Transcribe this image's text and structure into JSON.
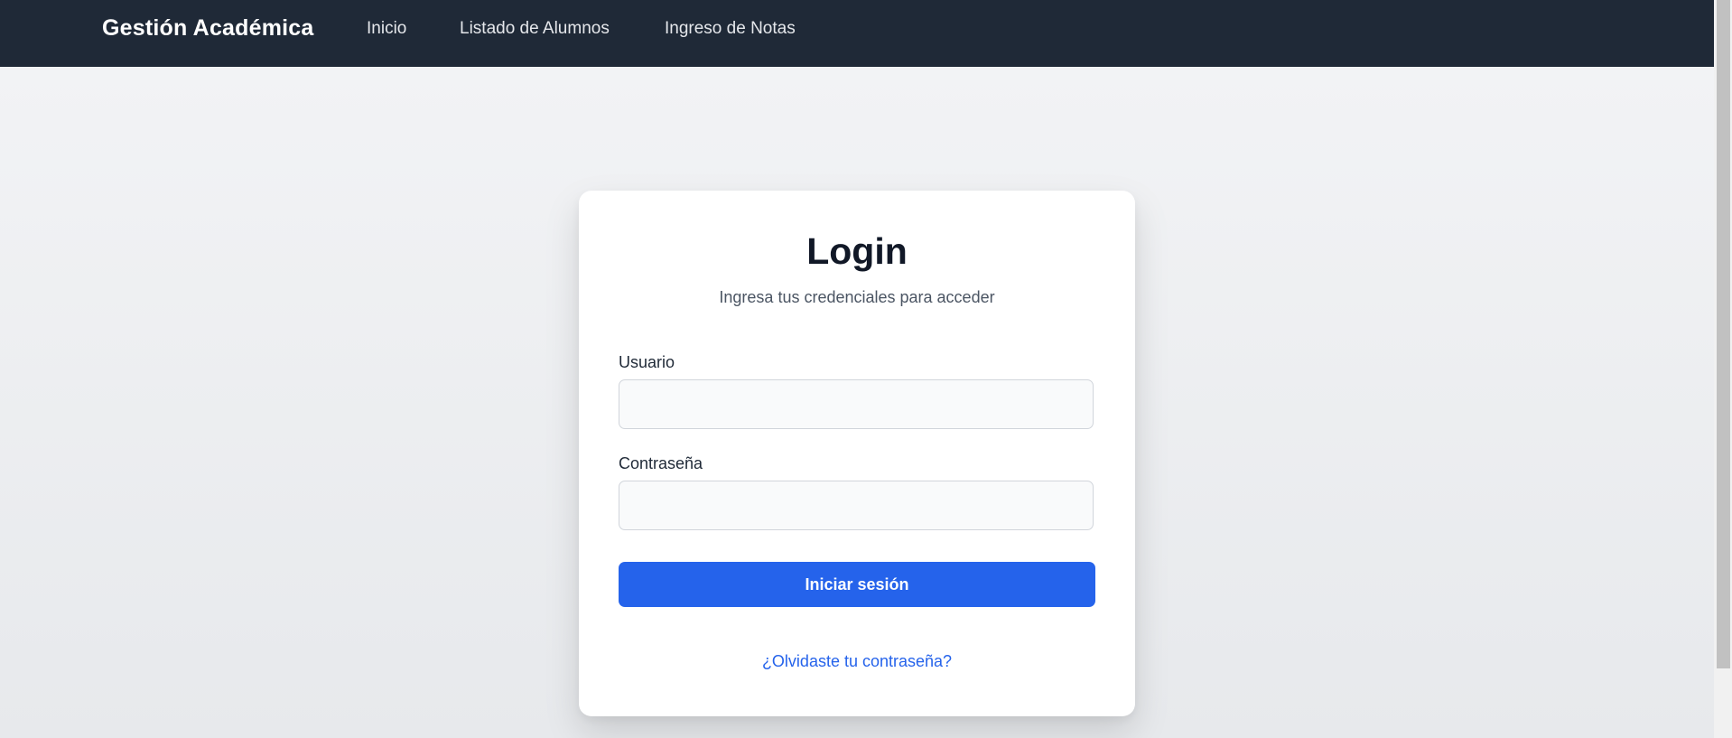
{
  "navbar": {
    "brand": "Gestión Académica",
    "links": [
      {
        "label": "Inicio"
      },
      {
        "label": "Listado de Alumnos"
      },
      {
        "label": "Ingreso de Notas"
      }
    ]
  },
  "login": {
    "title": "Login",
    "subtitle": "Ingresa tus credenciales para acceder",
    "username_label": "Usuario",
    "username_value": "",
    "password_label": "Contraseña",
    "password_value": "",
    "submit_label": "Iniciar sesión",
    "forgot_label": "¿Olvidaste tu contraseña?"
  },
  "colors": {
    "navbar_bg": "#1f2937",
    "primary": "#2563eb"
  }
}
